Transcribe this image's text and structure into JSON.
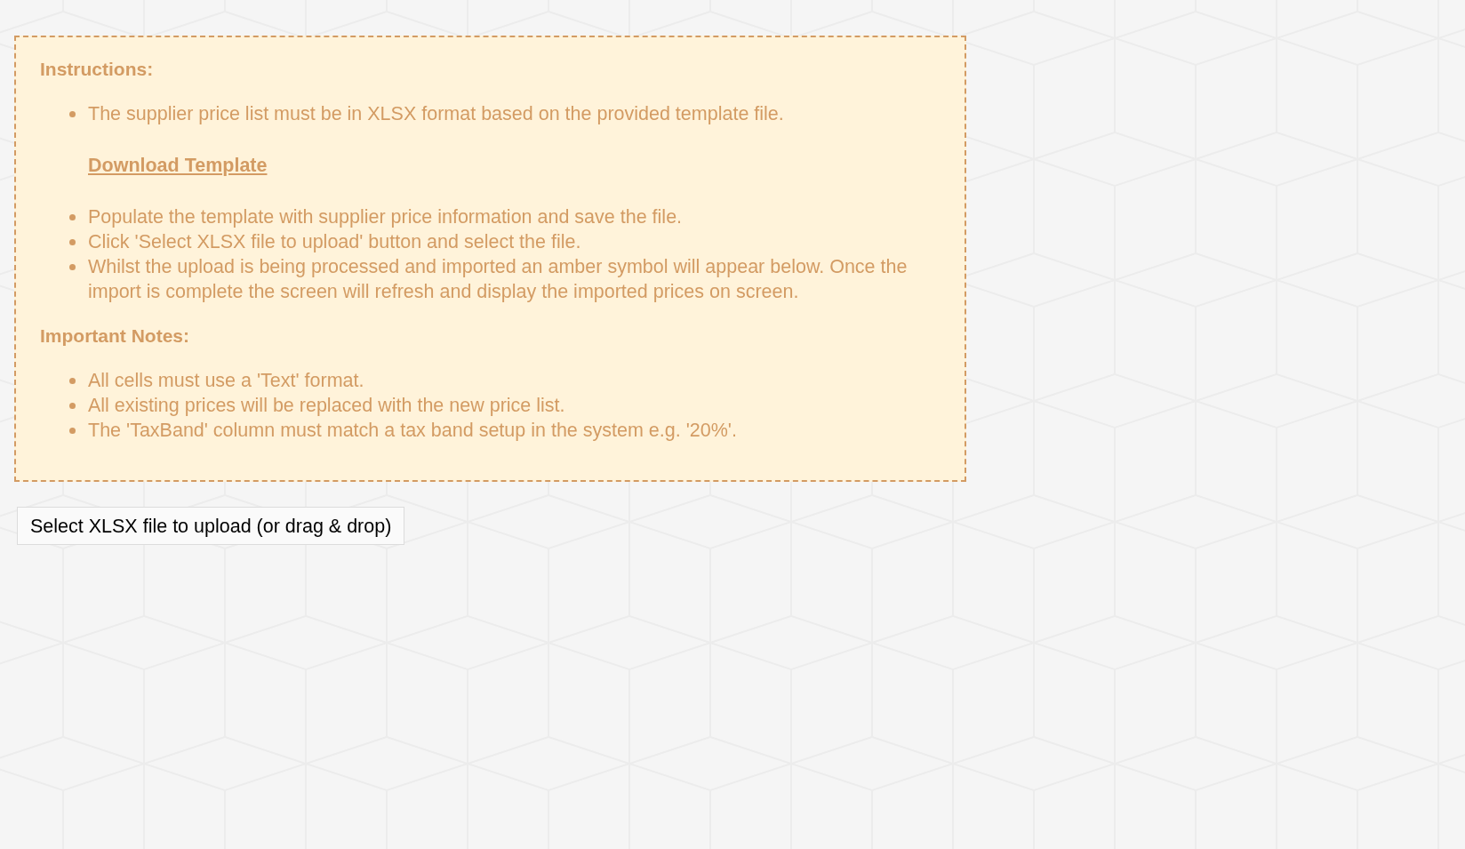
{
  "instructions": {
    "heading": "Instructions:",
    "items": [
      {
        "text": "The supplier price list must be in XLSX format based on the provided template file.",
        "link": "Download Template"
      },
      {
        "text": "Populate the template with supplier price information and save the file."
      },
      {
        "text": "Click 'Select XLSX file to upload' button and select the file."
      },
      {
        "text": "Whilst the upload is being processed and imported an amber symbol will appear below. Once the import is complete the screen will refresh and display the imported prices on screen."
      }
    ]
  },
  "important_notes": {
    "heading": "Important Notes:",
    "items": [
      {
        "text": "All cells must use a 'Text' format."
      },
      {
        "text": "All existing prices will be replaced with the new price list."
      },
      {
        "text": "The 'TaxBand' column must match a tax band setup in the system e.g. '20%'."
      }
    ]
  },
  "upload_button": {
    "label": "Select XLSX file to upload (or drag & drop)"
  }
}
